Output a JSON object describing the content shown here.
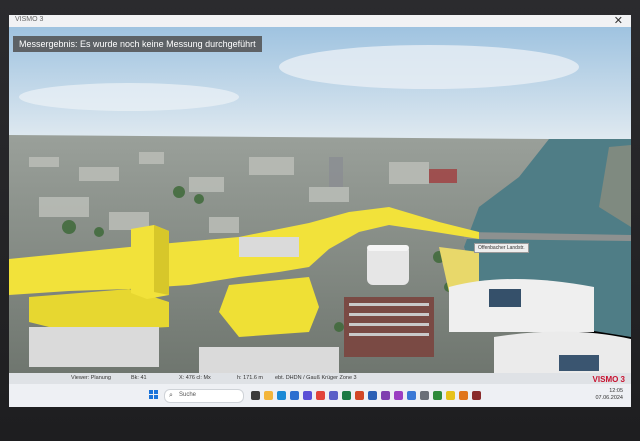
{
  "window": {
    "title": "VISMO 3",
    "close_glyph": "✕"
  },
  "overlay": {
    "message": "Messergebnis: Es wurde noch keine Messung durchgeführt",
    "street_label": "Offenbacher Landstr."
  },
  "statusbar": {
    "item1": "Viewer: Planung",
    "item2": "Bk: 41",
    "item3": "X: 476 cl: Mx",
    "item4": "h: 171.6 m",
    "item5": "ebt. DHDN / Gauß Krüger Zone 3",
    "brand": "VISMO 3"
  },
  "taskbar": {
    "search_label": "Suche",
    "search_icon": "search-icon",
    "start_icon": "windows-start-icon",
    "clock_time": "12:05",
    "clock_date": "07.06.2024",
    "pinned_apps": [
      {
        "name": "task-view-icon",
        "color": "#3b3b3b"
      },
      {
        "name": "file-explorer-icon",
        "color": "#f3b53b"
      },
      {
        "name": "edge-icon",
        "color": "#1b8ad6"
      },
      {
        "name": "mail-icon",
        "color": "#2d6fd0"
      },
      {
        "name": "store-icon",
        "color": "#5a4fd6"
      },
      {
        "name": "chrome-icon",
        "color": "#e2443a"
      },
      {
        "name": "teams-icon",
        "color": "#5b5fc7"
      },
      {
        "name": "excel-icon",
        "color": "#1d7a45"
      },
      {
        "name": "powerpoint-icon",
        "color": "#d24726"
      },
      {
        "name": "word-icon",
        "color": "#2b5fb5"
      },
      {
        "name": "onenote-icon",
        "color": "#7f3fb0"
      },
      {
        "name": "app-purple-icon",
        "color": "#9b3fc2"
      },
      {
        "name": "app-blue-icon",
        "color": "#3a78d6"
      },
      {
        "name": "app-grey-icon",
        "color": "#6a6f78"
      },
      {
        "name": "app-green-icon",
        "color": "#2f8a3b"
      },
      {
        "name": "app-yellow-icon",
        "color": "#e7c21a"
      },
      {
        "name": "app-orange-icon",
        "color": "#e0751c"
      },
      {
        "name": "vismo-taskbar-icon",
        "color": "#8a2b2b"
      }
    ]
  },
  "colors": {
    "highlight": "#f2e23a",
    "water": "#4f7d86",
    "sky": "#b9d3e6"
  }
}
